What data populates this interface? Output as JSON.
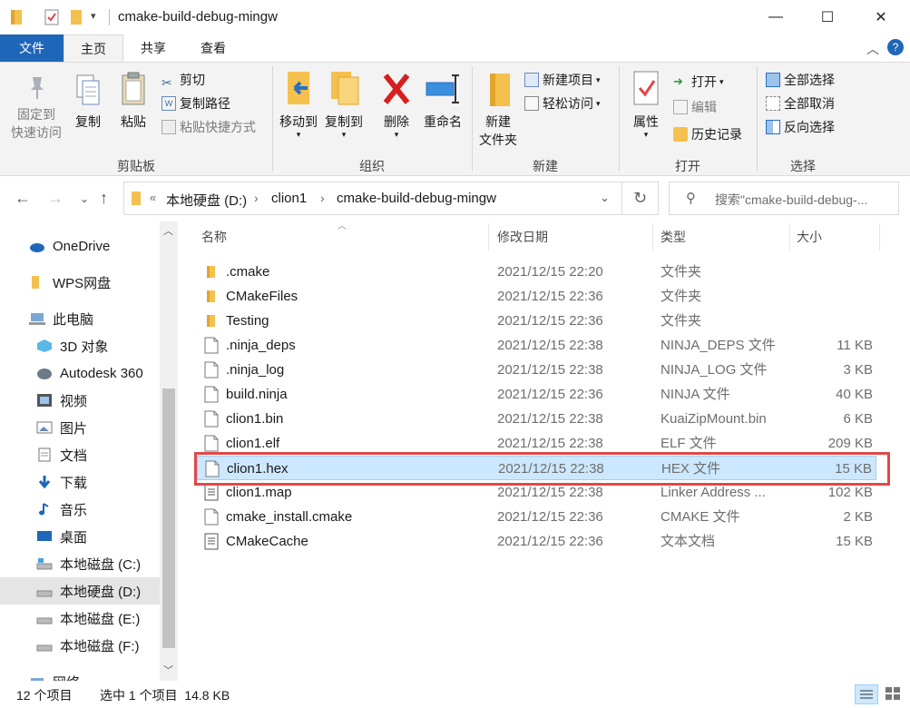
{
  "window": {
    "title": "cmake-build-debug-mingw",
    "minimize": "—",
    "maximize": "☐",
    "close": "✕"
  },
  "tabs": {
    "file": "文件",
    "home": "主页",
    "share": "共享",
    "view": "查看"
  },
  "ribbon": {
    "clipboard": {
      "pin_label_1": "固定到",
      "pin_label_2": "快速访问",
      "copy": "复制",
      "paste": "粘贴",
      "cut": "剪切",
      "copy_path": "复制路径",
      "paste_shortcut": "粘贴快捷方式",
      "group": "剪贴板"
    },
    "organize": {
      "move_to": "移动到",
      "copy_to": "复制到",
      "delete": "删除",
      "rename": "重命名",
      "group": "组织"
    },
    "new": {
      "new_folder_1": "新建",
      "new_folder_2": "文件夹",
      "new_item": "新建项目",
      "easy_access": "轻松访问",
      "group": "新建"
    },
    "open": {
      "properties": "属性",
      "open": "打开",
      "edit": "编辑",
      "history": "历史记录",
      "group": "打开"
    },
    "select": {
      "select_all": "全部选择",
      "select_none": "全部取消",
      "invert": "反向选择",
      "group": "选择"
    }
  },
  "address": {
    "prefix": "«",
    "crumbs": [
      "本地硬盘 (D:)",
      "clion1",
      "cmake-build-debug-mingw"
    ],
    "search_placeholder": "搜索\"cmake-build-debug-..."
  },
  "nav": {
    "items": [
      {
        "label": "OneDrive",
        "icon": "cloud-icon"
      },
      {
        "label": "WPS网盘",
        "icon": "folder-icon"
      },
      {
        "label": "此电脑",
        "icon": "computer-icon"
      },
      {
        "label": "3D 对象",
        "icon": "cube-icon"
      },
      {
        "label": "Autodesk 360",
        "icon": "autodesk-icon"
      },
      {
        "label": "视频",
        "icon": "video-icon"
      },
      {
        "label": "图片",
        "icon": "picture-icon"
      },
      {
        "label": "文档",
        "icon": "document-icon"
      },
      {
        "label": "下载",
        "icon": "download-icon"
      },
      {
        "label": "音乐",
        "icon": "music-icon"
      },
      {
        "label": "桌面",
        "icon": "desktop-icon"
      },
      {
        "label": "本地磁盘 (C:)",
        "icon": "drive-icon"
      },
      {
        "label": "本地硬盘 (D:)",
        "icon": "drive-icon"
      },
      {
        "label": "本地磁盘 (E:)",
        "icon": "drive-icon"
      },
      {
        "label": "本地磁盘 (F:)",
        "icon": "drive-icon"
      },
      {
        "label": "网络",
        "icon": "network-icon"
      }
    ]
  },
  "columns": {
    "name": "名称",
    "date": "修改日期",
    "type": "类型",
    "size": "大小"
  },
  "files": [
    {
      "name": ".cmake",
      "date": "2021/12/15 22:20",
      "type": "文件夹",
      "size": "",
      "kind": "folder"
    },
    {
      "name": "CMakeFiles",
      "date": "2021/12/15 22:36",
      "type": "文件夹",
      "size": "",
      "kind": "folder"
    },
    {
      "name": "Testing",
      "date": "2021/12/15 22:36",
      "type": "文件夹",
      "size": "",
      "kind": "folder"
    },
    {
      "name": ".ninja_deps",
      "date": "2021/12/15 22:38",
      "type": "NINJA_DEPS 文件",
      "size": "11 KB",
      "kind": "file"
    },
    {
      "name": ".ninja_log",
      "date": "2021/12/15 22:38",
      "type": "NINJA_LOG 文件",
      "size": "3 KB",
      "kind": "file"
    },
    {
      "name": "build.ninja",
      "date": "2021/12/15 22:36",
      "type": "NINJA 文件",
      "size": "40 KB",
      "kind": "file"
    },
    {
      "name": "clion1.bin",
      "date": "2021/12/15 22:38",
      "type": "KuaiZipMount.bin",
      "size": "6 KB",
      "kind": "file"
    },
    {
      "name": "clion1.elf",
      "date": "2021/12/15 22:38",
      "type": "ELF 文件",
      "size": "209 KB",
      "kind": "file"
    },
    {
      "name": "clion1.hex",
      "date": "2021/12/15 22:38",
      "type": "HEX 文件",
      "size": "15 KB",
      "kind": "file"
    },
    {
      "name": "clion1.map",
      "date": "2021/12/15 22:38",
      "type": "Linker Address ...",
      "size": "102 KB",
      "kind": "text"
    },
    {
      "name": "cmake_install.cmake",
      "date": "2021/12/15 22:36",
      "type": "CMAKE 文件",
      "size": "2 KB",
      "kind": "file"
    },
    {
      "name": "CMakeCache",
      "date": "2021/12/15 22:36",
      "type": "文本文档",
      "size": "15 KB",
      "kind": "text"
    }
  ],
  "selected_file": "clion1.hex",
  "status": {
    "count": "12 个项目",
    "selection": "选中 1 个项目  14.8 KB"
  },
  "colors": {
    "accent": "#1e66b8",
    "selection": "#cce8ff",
    "highlight_box": "#e04848",
    "folder": "#f4c04e"
  }
}
